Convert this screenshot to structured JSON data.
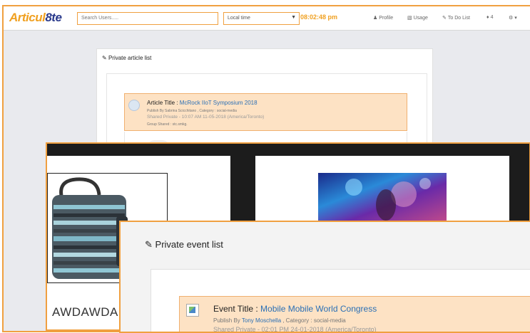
{
  "app": {
    "logo_main": "Articul",
    "logo_accent": "8te",
    "search_placeholder": "Search Users.....",
    "timezone_label": "Local time",
    "clock": "08:02:48 pm",
    "nav": {
      "profile": "Profile",
      "usage": "Usage",
      "todo": "To Do List",
      "notifications": "4"
    }
  },
  "articles": {
    "section_title": "Private article list",
    "item": {
      "title_prefix": "Article Title : ",
      "title": "McRock IIoT Symposium 2018",
      "publish": "Publish By Sabrina Scicchitano , Category : social-media",
      "shared": "Shared Private - 10:07 AM 11-05-2018 (America/Toronto)",
      "group": "Group Shared : stc.smkg."
    }
  },
  "gallery": {
    "product_name": "AWDAWDA"
  },
  "events": {
    "section_title": "Private event list",
    "item": {
      "title_prefix": "Event Title : ",
      "title": "Mobile Mobile World Congress",
      "publish_prefix": "Publish By ",
      "publisher": "Tony Moschella",
      "category": " , Category : social-media",
      "shared": "Shared Private - 02:01 PM 24-01-2018 (America/Toronto)"
    }
  },
  "icons": {
    "edit": "edit-icon",
    "user": "user-icon",
    "usage": "usage-icon",
    "bell": "bell-icon",
    "gear": "gear-icon"
  },
  "colors": {
    "accent": "#f0a040",
    "brand_blue": "#2a3a8c",
    "link": "#2a6fb5",
    "card_highlight": "#fde2c4"
  }
}
